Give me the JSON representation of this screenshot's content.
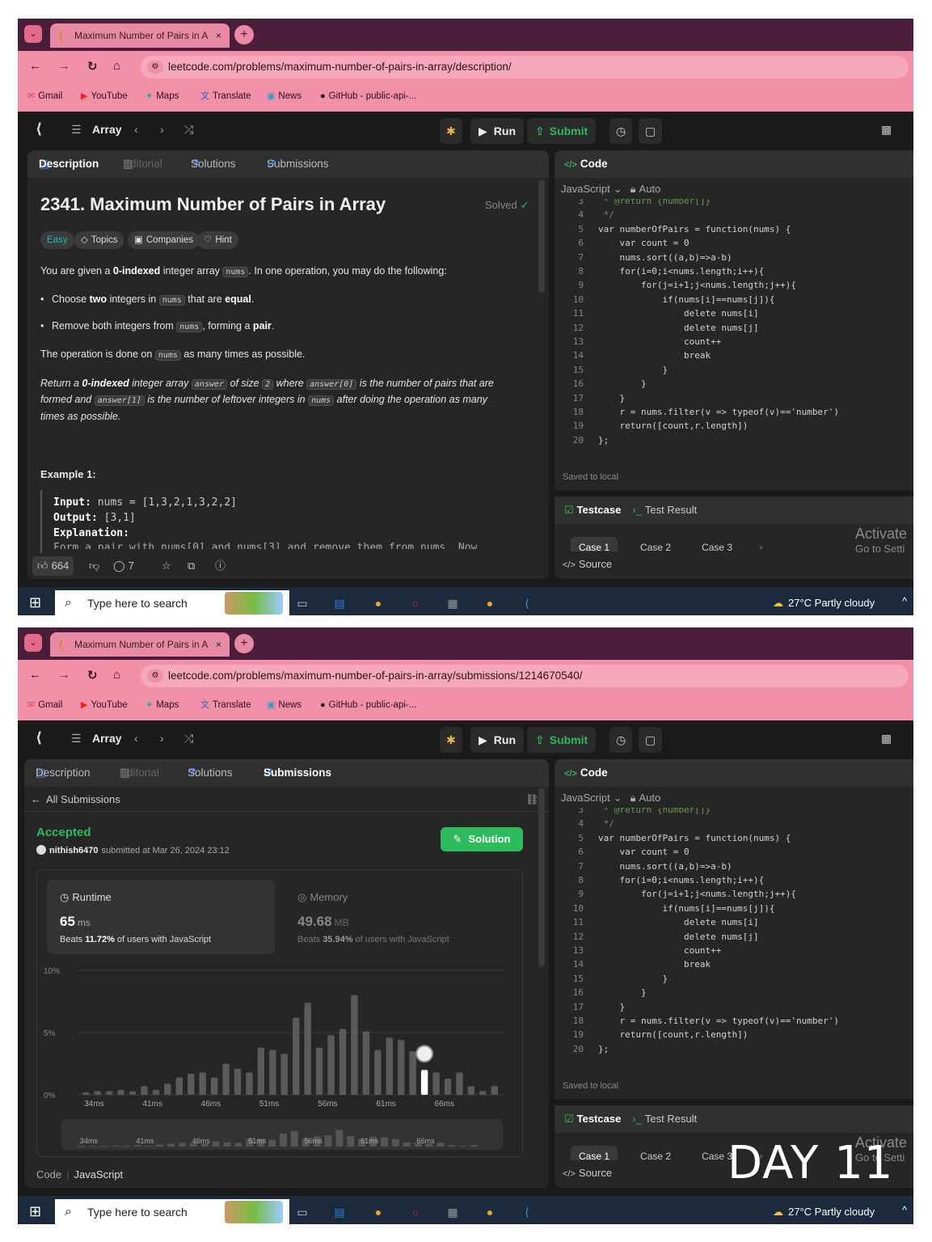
{
  "browser": {
    "tab_title": "Maximum Number of Pairs in A",
    "tab_close": "×",
    "new_tab": "+",
    "url_1": "leetcode.com/problems/maximum-number-of-pairs-in-array/description/",
    "url_2": "leetcode.com/problems/maximum-number-of-pairs-in-array/submissions/1214670540/",
    "bookmarks": [
      "Gmail",
      "YouTube",
      "Maps",
      "Translate",
      "News",
      "GitHub - public-api-..."
    ]
  },
  "lc_header": {
    "list_label": "Array",
    "run_label": "Run",
    "submit_label": "Submit"
  },
  "left_tabs": {
    "description": "Description",
    "editorial": "Editorial",
    "solutions": "Solutions",
    "submissions": "Submissions"
  },
  "problem": {
    "title": "2341. Maximum Number of Pairs in Array",
    "status": "Solved",
    "difficulty": "Easy",
    "chips": [
      "Topics",
      "Companies",
      "Hint"
    ],
    "p1_a": "You are given a ",
    "p1_b": "0-indexed",
    "p1_c": " integer array ",
    "p1_d": "nums",
    "p1_e": ". In one operation, you may do the following:",
    "b1_a": "Choose ",
    "b1_b": "two",
    "b1_c": " integers in ",
    "b1_d": "nums",
    "b1_e": " that are ",
    "b1_f": "equal",
    "b1_g": ".",
    "b2_a": "Remove both integers from ",
    "b2_b": "nums",
    "b2_c": ", forming a ",
    "b2_d": "pair",
    "b2_e": ".",
    "p2_a": "The operation is done on ",
    "p2_b": "nums",
    "p2_c": " as many times as possible.",
    "r1_a": "Return a ",
    "r1_b": "0-indexed",
    "r1_c": " integer array ",
    "r1_d": "answer",
    "r1_e": " of size ",
    "r1_f": "2",
    "r1_g": " where ",
    "r1_h": "answer[0]",
    "r1_i": " is the number of pairs that are",
    "r2_a": "formed and ",
    "r2_b": "answer[1]",
    "r2_c": " is the number of leftover integers in ",
    "r2_d": "nums",
    "r2_e": " after doing the operation as many",
    "r3": "times as possible.",
    "example_title": "Example 1:",
    "ex_input_label": "Input:",
    "ex_input": " nums = [1,3,2,1,3,2,2]",
    "ex_output_label": "Output:",
    "ex_output": " [3,1]",
    "ex_expl_label": "Explanation:",
    "ex_expl_cut": "Form a pair with nums[0] and nums[3] and remove them from nums. Now",
    "likes": "664",
    "comments": "7"
  },
  "submission": {
    "back_label": "All Submissions",
    "status": "Accepted",
    "user": "nithish6470",
    "submitted_text": "submitted at Mar 26, 2024 23:12",
    "solution_button": "Solution",
    "runtime_label": "Runtime",
    "runtime_value": "65",
    "runtime_unit": "ms",
    "runtime_beats_a": "Beats ",
    "runtime_beats_pct": "11.72%",
    "runtime_beats_b": " of users with JavaScript",
    "memory_label": "Memory",
    "memory_value": "49.68",
    "memory_unit": "MB",
    "memory_beats_a": "Beats ",
    "memory_beats_pct": "35.94%",
    "memory_beats_b": " of users with JavaScript",
    "footer_code": "Code",
    "footer_lang": "JavaScript"
  },
  "chart_data": {
    "type": "bar",
    "ylabels": [
      "10%",
      "5%",
      "0%"
    ],
    "ylim": [
      0,
      10
    ],
    "x_tick_labels": [
      "34ms",
      "41ms",
      "46ms",
      "51ms",
      "56ms",
      "61ms",
      "66ms"
    ],
    "values": [
      0.2,
      0.3,
      0.3,
      0.4,
      0.3,
      0.7,
      0.4,
      0.9,
      1.4,
      1.7,
      1.8,
      1.4,
      2.5,
      2.1,
      1.8,
      3.8,
      3.6,
      3.3,
      6.2,
      7.4,
      3.8,
      4.8,
      5.3,
      8.0,
      5.1,
      3.6,
      4.6,
      4.4,
      3.5,
      2.0,
      1.8,
      1.3,
      1.8,
      0.7,
      0.3,
      0.7
    ],
    "highlight_index": 29
  },
  "code_panel": {
    "title": "Code",
    "language": "JavaScript",
    "mode": "Auto",
    "saved": "Saved to local",
    "testcase": "Testcase",
    "test_result": "Test Result",
    "cases": [
      "Case 1",
      "Case 2",
      "Case 3"
    ],
    "source": "Source",
    "lines": [
      {
        "n": "3",
        "t": " * @return {number[]}"
      },
      {
        "n": "4",
        "t": " */"
      },
      {
        "n": "5",
        "t": "var numberOfPairs = function(nums) {"
      },
      {
        "n": "6",
        "t": "    var count = 0"
      },
      {
        "n": "7",
        "t": "    nums.sort((a,b)=>a-b)"
      },
      {
        "n": "8",
        "t": "    for(i=0;i<nums.length;i++){"
      },
      {
        "n": "9",
        "t": "        for(j=i+1;j<nums.length;j++){"
      },
      {
        "n": "10",
        "t": "            if(nums[i]==nums[j]){"
      },
      {
        "n": "11",
        "t": "                delete nums[i]"
      },
      {
        "n": "12",
        "t": "                delete nums[j]"
      },
      {
        "n": "13",
        "t": "                count++"
      },
      {
        "n": "14",
        "t": "                break"
      },
      {
        "n": "15",
        "t": "            }"
      },
      {
        "n": "16",
        "t": "        }"
      },
      {
        "n": "17",
        "t": "    }"
      },
      {
        "n": "18",
        "t": "    r = nums.filter(v => typeof(v)=='number')"
      },
      {
        "n": "19",
        "t": "    return([count,r.length])"
      },
      {
        "n": "20",
        "t": "};"
      }
    ]
  },
  "watermark": {
    "line1": "Activate",
    "line2": "Go to Setti"
  },
  "taskbar": {
    "search_placeholder": "Type here to search",
    "weather": "27°C  Partly cloudy"
  },
  "overlay_text": "DAY 11"
}
